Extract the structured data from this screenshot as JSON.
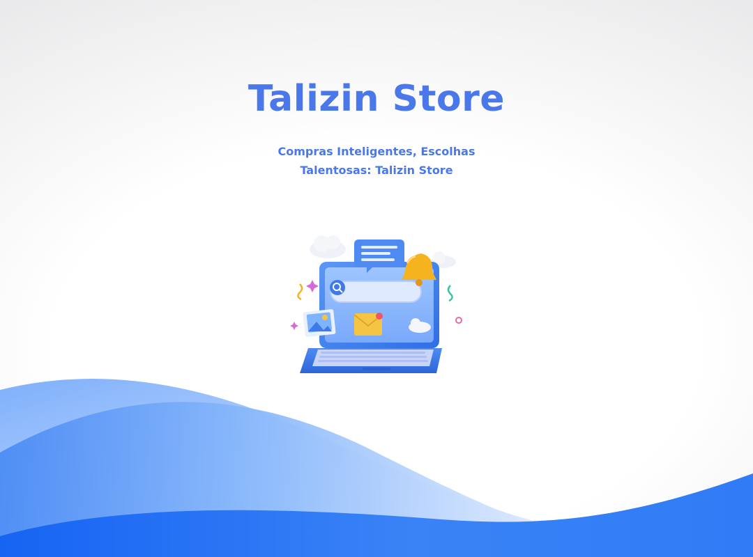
{
  "hero": {
    "title": "Talizin Store",
    "subtitle": "Compras Inteligentes, Escolhas Talentosas: Talizin Store"
  },
  "illustration": {
    "icon": "laptop-online-shopping-icon"
  },
  "colors": {
    "accent": "#4a78ea",
    "wave_deep": "#1f6cf5",
    "wave_light": "#9cc2fb"
  }
}
